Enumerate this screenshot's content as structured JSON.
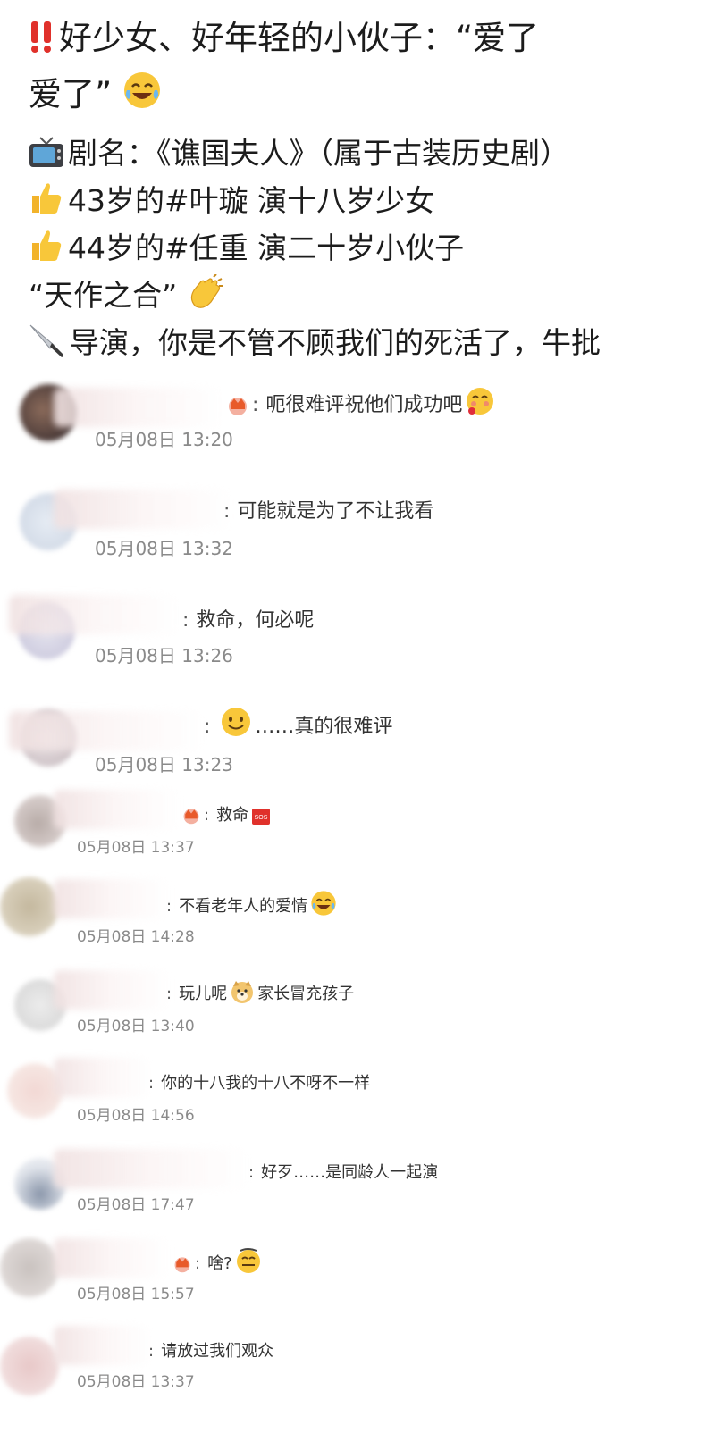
{
  "post": {
    "title_line1": "好少女、好年轻的小伙子：“爱了",
    "title_line2": "爱了”",
    "drama": "剧名：《谯国夫人》（属于古装历史剧）",
    "actor1": "43岁的#叶璇 演十八岁少女",
    "actor2": "44岁的#任重 演二十岁小伙子",
    "match": "“天作之合”",
    "director": "导演，你是不管不顾我们的死活了，牛批"
  },
  "comments": [
    {
      "text_before": "呃很难评祝他们成功吧",
      "text_after": "",
      "time": "05月08日 13:20"
    },
    {
      "text_before": "可能就是为了不让我看",
      "text_after": "",
      "time": "05月08日 13:32"
    },
    {
      "text_before": "救命，何必呢",
      "text_after": "",
      "time": "05月08日 13:26"
    },
    {
      "text_before": "",
      "text_after": "……真的很难评",
      "time": "05月08日 13:23"
    },
    {
      "text_before": "救命",
      "text_after": "",
      "time": "05月08日 13:37"
    },
    {
      "text_before": "不看老年人的爱情",
      "text_after": "",
      "time": "05月08日 14:28"
    },
    {
      "text_before": "玩儿呢",
      "text_after": "家长冒充孩子",
      "time": "05月08日 13:40"
    },
    {
      "text_before": "你的十八我的十八不呀不一样",
      "text_after": "",
      "time": "05月08日 14:56"
    },
    {
      "text_before": "好歹……是同龄人一起演",
      "text_after": "",
      "time": "05月08日 17:47"
    },
    {
      "text_before": "啥?",
      "text_after": "",
      "time": "05月08日 15:57"
    },
    {
      "text_before": "请放过我们观众",
      "text_after": "",
      "time": "05月08日 13:37"
    }
  ],
  "icons": {
    "post": [
      "double-exclamation-icon",
      "laughing-emoji-icon",
      "tv-icon",
      "thumbs-up-icon",
      "clapping-hands-icon",
      "knife-icon"
    ],
    "comments": [
      "crown-badge-icon",
      "shy-emoji-icon",
      "smile-emoji-icon",
      "sos-icon",
      "laughing-emoji-icon",
      "doge-icon",
      "dizzy-emoji-icon"
    ]
  },
  "colors": {
    "time_gray": "#8a8a8a",
    "text": "#222222",
    "background": "#ffffff",
    "alert_red": "#e0312b"
  }
}
